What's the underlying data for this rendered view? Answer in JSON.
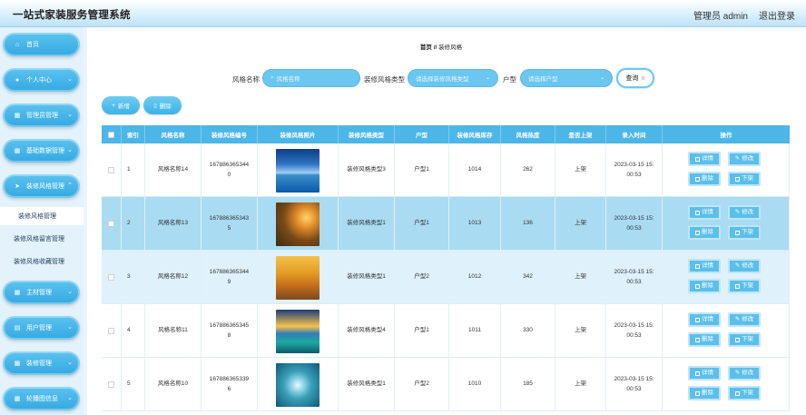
{
  "app": {
    "title": "一站式家装服务管理系统",
    "user": "管理员 admin",
    "logout": "退出登录"
  },
  "sidebar": {
    "items": [
      {
        "label": "首页",
        "icon": "home-icon",
        "glyph": "⌂"
      },
      {
        "label": "个人中心",
        "icon": "user-icon",
        "glyph": "👤"
      },
      {
        "label": "管理员管理",
        "icon": "grid-icon",
        "glyph": "▦"
      },
      {
        "label": "基础数据管理",
        "icon": "grid-icon",
        "glyph": "▦"
      },
      {
        "label": "装修风格管理",
        "icon": "send-icon",
        "glyph": "➤"
      },
      {
        "label": "主材管理",
        "icon": "grid-icon",
        "glyph": "▦"
      },
      {
        "label": "用户管理",
        "icon": "file-icon",
        "glyph": "▤"
      },
      {
        "label": "装修管理",
        "icon": "grid-icon",
        "glyph": "▦"
      },
      {
        "label": "轮播图信息",
        "icon": "grid-icon",
        "glyph": "▦"
      }
    ],
    "sub_items": [
      {
        "label": "装修风格管理"
      },
      {
        "label": "装修风格留言管理"
      },
      {
        "label": "装修风格收藏管理"
      }
    ]
  },
  "breadcrumb": {
    "home": "首页",
    "sep": "//",
    "current": "装修风格"
  },
  "search": {
    "name_label": "风格名称",
    "name_placeholder": "风格名称",
    "type_label": "装修风格类型",
    "type_placeholder": "请选择装修风格类型",
    "huxing_label": "户型",
    "huxing_placeholder": "请选择户型",
    "query": "查询"
  },
  "actions": {
    "add": "新增",
    "delete": "删除"
  },
  "table": {
    "headers": [
      "索引",
      "风格名称",
      "装修风格编号",
      "装修风格照片",
      "装修风格类型",
      "户型",
      "装修风格库存",
      "风格热度",
      "是否上架",
      "录入时间",
      "操作"
    ],
    "row_buttons": {
      "detail": "详情",
      "edit": "修改",
      "delete": "删除",
      "offshelf": "下架"
    },
    "rows": [
      {
        "index": "1",
        "name": "风格名称14",
        "code1": "167886365344",
        "code2": "0",
        "type": "装修风格类型3",
        "huxing": "户型1",
        "stock": "1014",
        "heat": "262",
        "shelf": "上架",
        "time1": "2023-03-15 15:",
        "time2": "00:53",
        "photo": "sea"
      },
      {
        "index": "2",
        "name": "风格名称13",
        "code1": "167886365343",
        "code2": "5",
        "type": "装修风格类型1",
        "huxing": "户型1",
        "stock": "1013",
        "heat": "136",
        "shelf": "上架",
        "time1": "2023-03-15 15:",
        "time2": "00:53",
        "photo": "sunset-tree"
      },
      {
        "index": "3",
        "name": "风格名称12",
        "code1": "167886365344",
        "code2": "9",
        "type": "装修风格类型1",
        "huxing": "户型2",
        "stock": "1012",
        "heat": "342",
        "shelf": "上架",
        "time1": "2023-03-15 15:",
        "time2": "00:53",
        "photo": "autumn-road"
      },
      {
        "index": "4",
        "name": "风格名称11",
        "code1": "167886365345",
        "code2": "8",
        "type": "装修风格类型4",
        "huxing": "户型1",
        "stock": "1011",
        "heat": "330",
        "shelf": "上架",
        "time1": "2023-03-15 15:",
        "time2": "00:53",
        "photo": "lake-sunrise"
      },
      {
        "index": "5",
        "name": "风格名称10",
        "code1": "167886365339",
        "code2": "6",
        "type": "装修风格类型1",
        "huxing": "户型2",
        "stock": "1010",
        "heat": "185",
        "shelf": "上架",
        "time1": "2023-03-15 15:",
        "time2": "00:53",
        "photo": "heart-island"
      }
    ]
  },
  "colors": {
    "accent": "#4cb6e6",
    "menu": "#3eaee3",
    "row_highlight": "#a9dbf3",
    "row_alt": "#dff1fa"
  }
}
